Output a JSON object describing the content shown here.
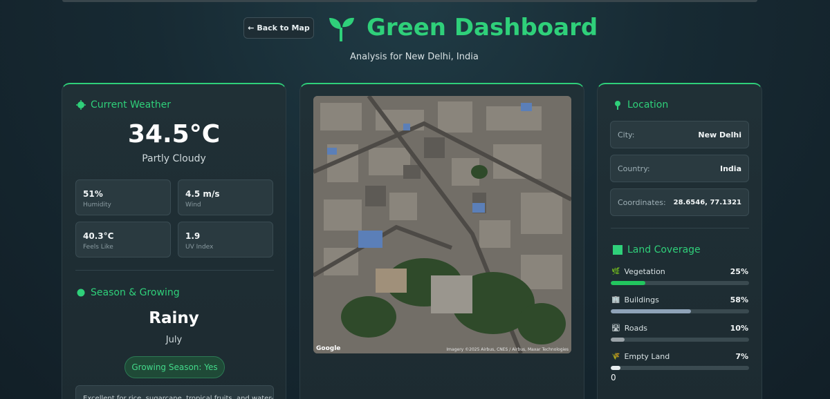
{
  "header": {
    "back_label": "← Back to Map",
    "title": "Green Dashboard",
    "subtitle": "Analysis for New Delhi, India"
  },
  "weather": {
    "heading": "Current Weather",
    "temperature": "34.5°C",
    "condition": "Partly Cloudy",
    "stats": [
      {
        "value": "51%",
        "label": "Humidity"
      },
      {
        "value": "4.5 m/s",
        "label": "Wind"
      },
      {
        "value": "40.3°C",
        "label": "Feels Like"
      },
      {
        "value": "1.9",
        "label": "UV Index"
      }
    ]
  },
  "season": {
    "heading": "Season & Growing",
    "name": "Rainy",
    "month": "July",
    "growing_badge": "Growing Season: Yes",
    "advice": "Excellent for rice, sugarcane, tropical fruits, and water-"
  },
  "map": {
    "google_label": "Google",
    "credit": "Imagery ©2025 Airbus, CNES / Airbus, Maxar Technologies"
  },
  "location": {
    "heading": "Location",
    "rows": [
      {
        "key": "City:",
        "value": "New Delhi"
      },
      {
        "key": "Country:",
        "value": "India"
      },
      {
        "key": "Coordinates:",
        "value": "28.6546, 77.1321"
      }
    ]
  },
  "coverage": {
    "heading": "Land Coverage",
    "items": [
      {
        "icon": "🌿",
        "label": "Vegetation",
        "pct": "25%",
        "fraction": 0.25,
        "color": "#22c55e"
      },
      {
        "icon": "🏢",
        "label": "Buildings",
        "pct": "58%",
        "fraction": 0.58,
        "color": "#8fa3b8"
      },
      {
        "icon": "🛣",
        "label": "Roads",
        "pct": "10%",
        "fraction": 0.1,
        "color": "#9aa3a8"
      },
      {
        "icon": "🌾",
        "label": "Empty Land",
        "pct": "7%",
        "fraction": 0.07,
        "color": "#e8eef0"
      }
    ],
    "stray_value": "0"
  },
  "colors": {
    "accent": "#2fd07a"
  }
}
